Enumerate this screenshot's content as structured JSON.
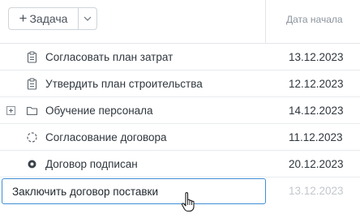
{
  "toolbar": {
    "add_task_label": "Задача",
    "add_icon": "plus-icon",
    "dropdown_icon": "chevron-down-icon"
  },
  "columns": {
    "start_date": "Дата начала"
  },
  "rows": [
    {
      "name": "Согласовать план затрат",
      "date": "13.12.2023",
      "icon": "clipboard-icon"
    },
    {
      "name": "Утвердить план строительства",
      "date": "12.12.2023",
      "icon": "clipboard-icon"
    },
    {
      "name": "Обучение персонала",
      "date": "14.12.2023",
      "icon": "folder-icon",
      "expandable": true
    },
    {
      "name": "Согласование договора",
      "date": "11.12.2023",
      "icon": "dashed-circle-icon"
    },
    {
      "name": "Договор подписан",
      "date": "20.12.2023",
      "icon": "milestone-icon"
    }
  ],
  "editing_row": {
    "value": "Заключить договор поставки",
    "date": "13.12.2023"
  },
  "colors": {
    "accent": "#3f8ed6",
    "border": "#e3e6e9",
    "muted_text": "#8c949c"
  }
}
